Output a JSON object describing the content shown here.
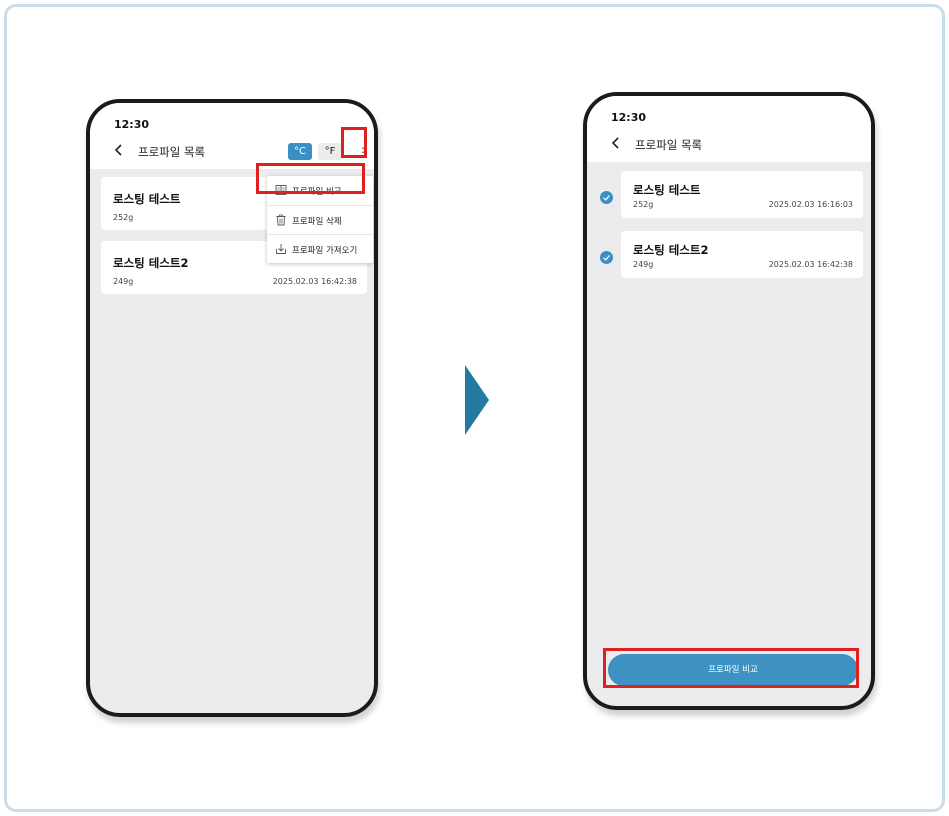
{
  "colors": {
    "accent": "#3a90c2",
    "highlight": "#e0201f",
    "arrow": "#247aa0",
    "frame": "#c9dce8"
  },
  "left_screen": {
    "time": "12:30",
    "title": "프로파일 목록",
    "back_icon": "chevron-left-icon",
    "unit_celsius": "°C",
    "unit_fahrenheit": "°F",
    "more_icon": "more-vertical-icon",
    "profiles": [
      {
        "name": "로스팅 테스트",
        "weight": "252g"
      },
      {
        "name": "로스팅 테스트2",
        "weight": "249g",
        "date": "2025.02.03 16:42:38"
      }
    ],
    "menu": [
      {
        "icon": "compare-icon",
        "label": "프로파일 비교"
      },
      {
        "icon": "trash-icon",
        "label": "프로파일 삭제"
      },
      {
        "icon": "import-icon",
        "label": "프로파일 가져오기"
      }
    ]
  },
  "right_screen": {
    "time": "12:30",
    "title": "프로파일 목록",
    "back_icon": "chevron-left-icon",
    "profiles": [
      {
        "name": "로스팅 테스트",
        "weight": "252g",
        "date": "2025.02.03 16:16:03",
        "checked": true
      },
      {
        "name": "로스팅 테스트2",
        "weight": "249g",
        "date": "2025.02.03 16:42:38",
        "checked": true
      }
    ],
    "compare_button": "프로파일 비교"
  },
  "arrow_icon": "arrow-right-icon"
}
